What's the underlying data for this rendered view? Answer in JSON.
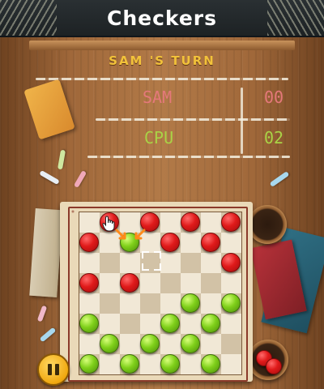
{
  "header": {
    "title": "Checkers"
  },
  "turn": {
    "label": "SAM 'S TURN"
  },
  "scoreboard": {
    "players": [
      {
        "name": "SAM",
        "score": "00",
        "color": "#e4787a"
      },
      {
        "name": "CPU",
        "score": "02",
        "color": "#a9d346"
      }
    ]
  },
  "board": {
    "rows": 8,
    "cols": 8,
    "pieces": [
      {
        "color": "red",
        "row": 0,
        "col": 1
      },
      {
        "color": "red",
        "row": 0,
        "col": 3
      },
      {
        "color": "red",
        "row": 0,
        "col": 5
      },
      {
        "color": "red",
        "row": 0,
        "col": 7
      },
      {
        "color": "red",
        "row": 1,
        "col": 0
      },
      {
        "color": "red",
        "row": 1,
        "col": 4
      },
      {
        "color": "red",
        "row": 1,
        "col": 6
      },
      {
        "color": "red",
        "row": 2,
        "col": 7
      },
      {
        "color": "red",
        "row": 3,
        "col": 0
      },
      {
        "color": "red",
        "row": 3,
        "col": 2
      },
      {
        "color": "green",
        "row": 1,
        "col": 2
      },
      {
        "color": "green",
        "row": 4,
        "col": 5
      },
      {
        "color": "green",
        "row": 4,
        "col": 7
      },
      {
        "color": "green",
        "row": 5,
        "col": 0
      },
      {
        "color": "green",
        "row": 5,
        "col": 4
      },
      {
        "color": "green",
        "row": 5,
        "col": 6
      },
      {
        "color": "green",
        "row": 6,
        "col": 1
      },
      {
        "color": "green",
        "row": 6,
        "col": 3
      },
      {
        "color": "green",
        "row": 6,
        "col": 5
      },
      {
        "color": "green",
        "row": 7,
        "col": 0
      },
      {
        "color": "green",
        "row": 7,
        "col": 2
      },
      {
        "color": "green",
        "row": 7,
        "col": 4
      },
      {
        "color": "green",
        "row": 7,
        "col": 6
      }
    ],
    "selected": {
      "row": 0,
      "col": 1
    },
    "target": {
      "row": 2,
      "col": 3
    },
    "cursor_icon": "hand-pointer-icon",
    "move_arrows_icon": "move-arrows-icon"
  },
  "controls": {
    "pause_icon": "pause-icon"
  },
  "colors": {
    "turn_label": "#f2c23a",
    "red_piece": "#e01a1a",
    "green_piece": "#7fd01a",
    "light_square": "#f1e8d6",
    "dark_square": "#d2c2a6"
  }
}
